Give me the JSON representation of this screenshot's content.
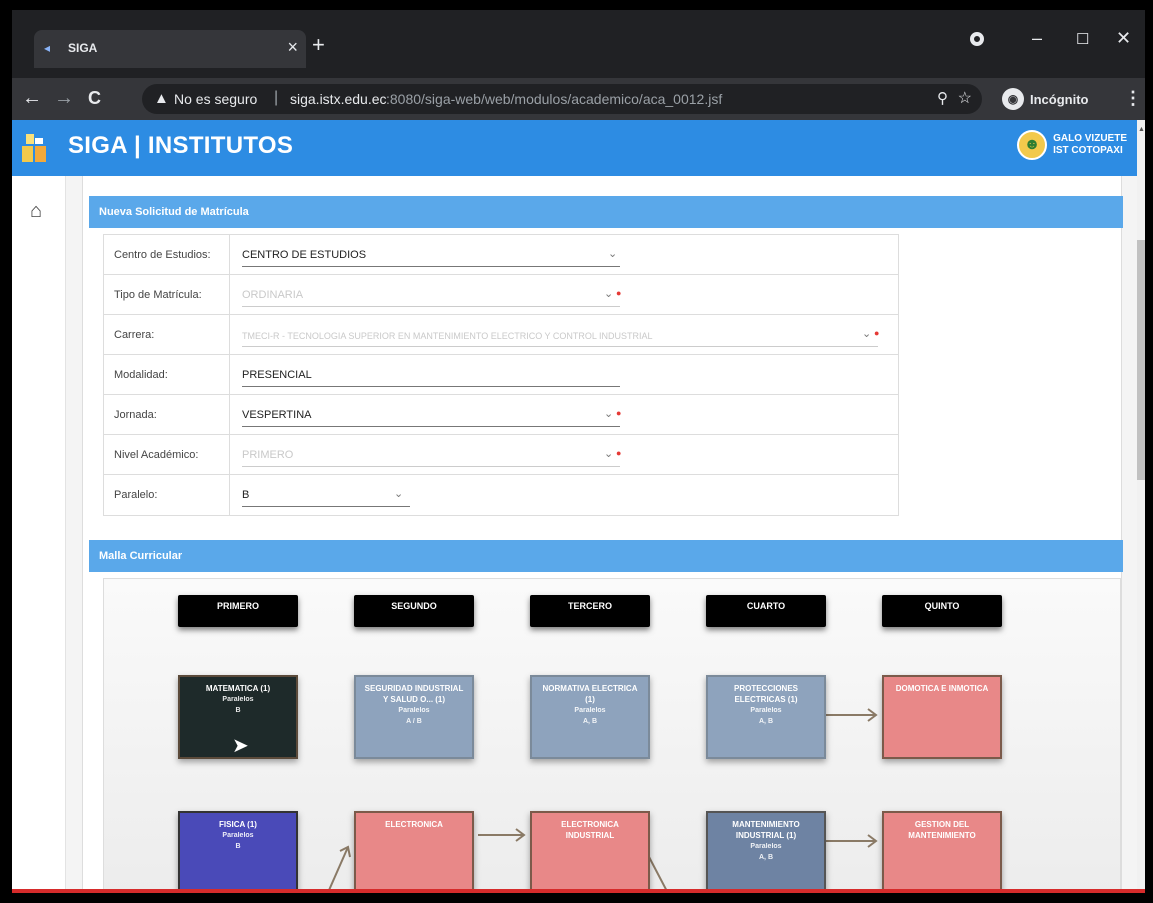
{
  "browser": {
    "tab_title": "SIGA",
    "tab_close": "×",
    "new_tab": "+",
    "back": "←",
    "forward": "→",
    "reload": "C",
    "security_icon": "▲",
    "security_label": "No es seguro",
    "separator": "|",
    "url_host": "siga.istx.edu.ec",
    "url_path": ":8080/siga-web/web/modulos/academico/aca_0012.jsf",
    "zoom_icon": "⚲",
    "star_icon": "☆",
    "incognito_label": "Incógnito",
    "menu": "⋮",
    "window_min": "–",
    "window_max": "☐",
    "window_close": "✕"
  },
  "header": {
    "brand": "SIGA | INSTITUTOS",
    "user_name": "GALO VIZUETE",
    "user_org": "IST COTOPAXI"
  },
  "form_panel": {
    "title": "Nueva Solicitud de Matrícula",
    "rows": [
      {
        "label": "Centro de Estudios:",
        "value": "CENTRO DE ESTUDIOS",
        "caret": "⌄",
        "req": ""
      },
      {
        "label": "Tipo de Matrícula:",
        "value": "ORDINARIA",
        "caret": "⌄",
        "req": "●"
      },
      {
        "label": "Carrera:",
        "value": "TMECI-R - TECNOLOGIA SUPERIOR EN MANTENIMIENTO ELECTRICO Y CONTROL INDUSTRIAL",
        "caret": "⌄",
        "req": "●"
      },
      {
        "label": "Modalidad:",
        "value": "PRESENCIAL",
        "caret": "",
        "req": ""
      },
      {
        "label": "Jornada:",
        "value": "VESPERTINA",
        "caret": "⌄",
        "req": "●"
      },
      {
        "label": "Nivel Académico:",
        "value": "PRIMERO",
        "caret": "⌄",
        "req": "●"
      },
      {
        "label": "Paralelo:",
        "value": "B",
        "caret": "⌄",
        "req": ""
      }
    ]
  },
  "malla_panel": {
    "title": "Malla Curricular",
    "levels": [
      "PRIMERO",
      "SEGUNDO",
      "TERCERO",
      "CUARTO",
      "QUINTO"
    ],
    "row1": [
      {
        "title": "MATEMATICA (1)",
        "line2": "Paralelos",
        "line3": "B"
      },
      {
        "title": "SEGURIDAD INDUSTRIAL Y SALUD O... (1)",
        "line2": "Paralelos",
        "line3": "A / B"
      },
      {
        "title": "NORMATIVA ELECTRICA (1)",
        "line2": "Paralelos",
        "line3": "A, B"
      },
      {
        "title": "PROTECCIONES ELECTRICAS (1)",
        "line2": "Paralelos",
        "line3": "A, B"
      },
      {
        "title": "DOMOTICA E INMOTICA",
        "line2": "",
        "line3": ""
      }
    ],
    "row2": [
      {
        "title": "FISICA (1)",
        "line2": "Paralelos",
        "line3": "B"
      },
      {
        "title": "ELECTRONICA",
        "line2": "",
        "line3": ""
      },
      {
        "title": "ELECTRONICA INDUSTRIAL",
        "line2": "",
        "line3": ""
      },
      {
        "title": "MANTENIMIENTO INDUSTRIAL (1)",
        "line2": "Paralelos",
        "line3": "A, B"
      },
      {
        "title": "GESTION DEL MANTENIMIENTO",
        "line2": "",
        "line3": ""
      }
    ]
  },
  "colors": {
    "header_blue": "#2d8ce3",
    "panel_blue": "#5aa8ea",
    "card_red": "#e88888",
    "card_grey": "#8ea3bd",
    "card_dark": "#1e2a2a",
    "card_purple": "#4a4ab8"
  }
}
